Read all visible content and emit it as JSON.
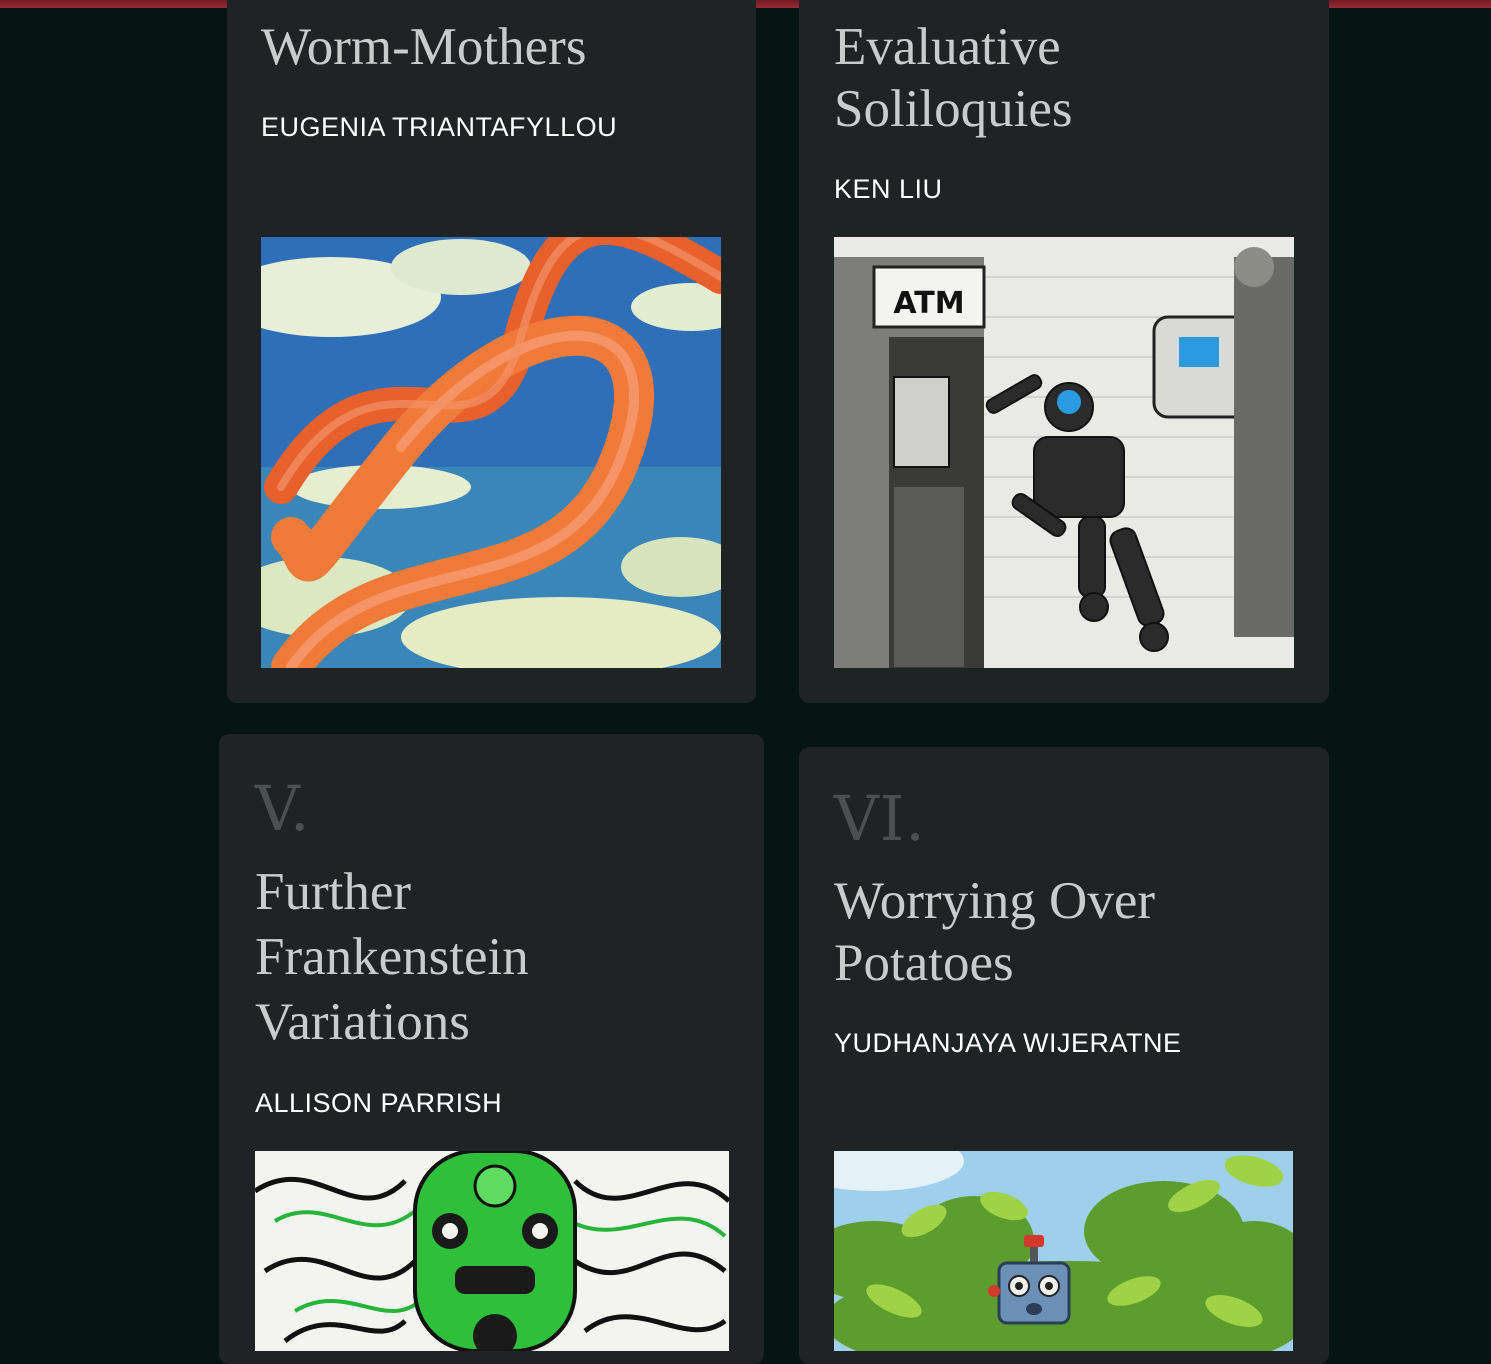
{
  "cards": [
    {
      "numeral": "",
      "title": "Worm-Mothers",
      "author": "EUGENIA TRIANTAFYLLOU",
      "art_subject": "orange-worm-over-clouds-painting"
    },
    {
      "numeral": "",
      "title_line1": "Evaluative",
      "title_line2": "Soliloquies",
      "author": "KEN LIU",
      "art_subject": "robot-at-atm-sketch",
      "art_text": "ATM"
    },
    {
      "numeral": "V.",
      "title_line1": "Further",
      "title_line2": "Frankenstein",
      "title_line3": "Variations",
      "author": "ALLISON PARRISH",
      "art_subject": "green-robot-with-tendrils-drawing"
    },
    {
      "numeral": "VI.",
      "title_line1": "Worrying Over",
      "title_line2": "Potatoes",
      "author": "YUDHANJAYA WIJERATNE",
      "art_subject": "blue-robot-in-potato-plants-painting"
    }
  ],
  "colors": {
    "page_bg": "#061412",
    "card_bg": "#1f2324",
    "accent_bar": "#9a2a30"
  }
}
